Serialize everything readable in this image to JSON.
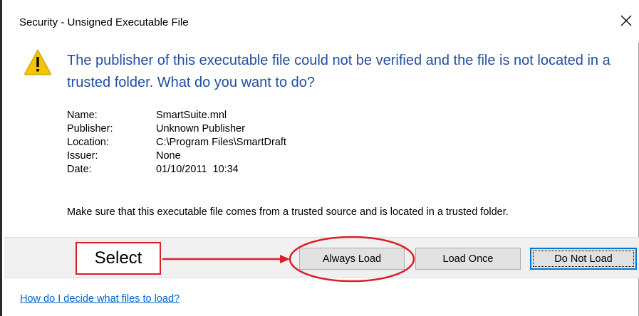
{
  "window": {
    "title": "Security - Unsigned Executable File",
    "close_label": "✕"
  },
  "headline": "The publisher of this executable file could not be verified and the file is not located in a trusted folder. What do you want to do?",
  "details": [
    {
      "key": "Name:",
      "value": "SmartSuite.mnl"
    },
    {
      "key": "Publisher:",
      "value": "Unknown Publisher"
    },
    {
      "key": "Location:",
      "value": "C:\\Program Files\\SmartDraft"
    },
    {
      "key": "Issuer:",
      "value": "None"
    },
    {
      "key": "Date:",
      "value": "01/10/2011  10:34"
    }
  ],
  "advice": "Make sure that this executable file comes from a trusted source and is located in a trusted folder.",
  "buttons": {
    "always_load": "Always Load",
    "load_once": "Load Once",
    "do_not_load": "Do Not Load"
  },
  "annotation": {
    "label": "Select",
    "color": "#d9202a"
  },
  "help_link": "How do I decide what files to load?",
  "colors": {
    "headline": "#1f4e9e",
    "link": "#0066cc",
    "warning": "#f5c400",
    "focus": "#0078d7"
  },
  "icons": {
    "warning": "warning-icon",
    "close": "close-icon"
  }
}
